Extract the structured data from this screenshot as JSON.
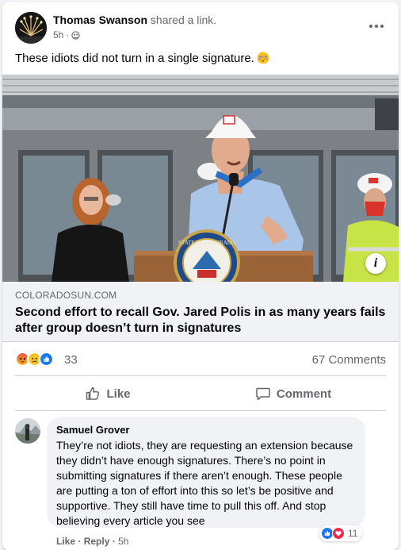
{
  "post": {
    "author": "Thomas Swanson",
    "action": "shared a link.",
    "time": "5h",
    "privacy_icon": "friends-icon",
    "text": "These idiots did not turn in a single signature.",
    "emoji": "flushed-face-emoji"
  },
  "link": {
    "domain": "COLORADOSUN.COM",
    "title": "Second effort to recall Gov. Jared Polis in as many years fails after group doesn’t turn in signatures",
    "info_icon_label": "i",
    "seal_text": "STATE OF COLORADO"
  },
  "engagement": {
    "reaction_icons": [
      "angry-icon",
      "sad-icon",
      "like-icon"
    ],
    "reaction_count": "33",
    "comments_count": "67 Comments"
  },
  "actions": {
    "like_label": "Like",
    "comment_label": "Comment"
  },
  "comment": {
    "author": "Samuel Grover",
    "text": "They’re not idiots, they are requesting an extension because they didn’t have enough signatures. There’s no point in submitting signatures if there aren’t enough. These people are putting a ton of effort into this so let’s be positive and supportive. They still have time to pull this off. And stop believing every article you see",
    "reaction_icons": [
      "like-icon",
      "love-icon"
    ],
    "reaction_count": "11",
    "like_label": "Like",
    "reply_label": "Reply",
    "time": "5h"
  },
  "colors": {
    "facebook_blue": "#1877f2",
    "secondary_text": "#65676b",
    "bubble_bg": "#f0f2f5"
  }
}
